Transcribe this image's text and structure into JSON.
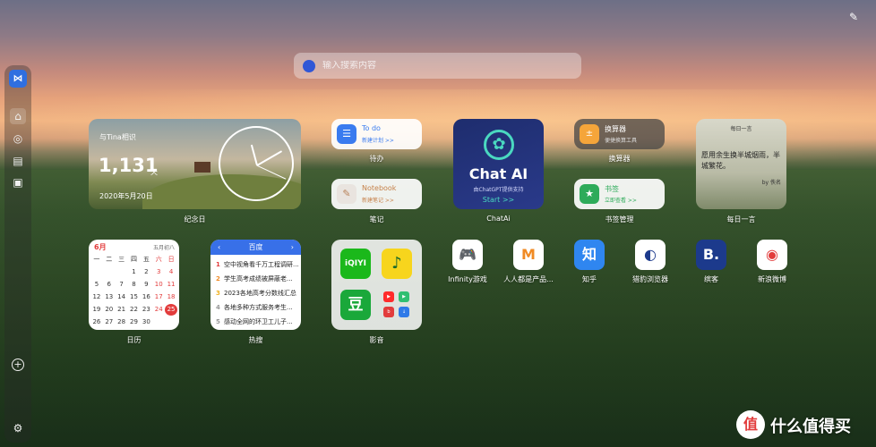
{
  "search": {
    "placeholder": "输入搜索内容"
  },
  "sidebar": {
    "items": [
      {
        "name": "home",
        "glyph": "⌂"
      },
      {
        "name": "compass",
        "glyph": "◎"
      },
      {
        "name": "store",
        "glyph": "▤"
      },
      {
        "name": "box",
        "glyph": "▣"
      }
    ],
    "add_glyph": "+",
    "settings_glyph": "⚙"
  },
  "anniversary": {
    "label": "与Tina相识",
    "count": "1,131",
    "unit": "天",
    "date": "2020年5月20日",
    "caption": "纪念日"
  },
  "todo": {
    "title": "To do",
    "subtitle": "新建计划 >>",
    "caption": "待办"
  },
  "notebook": {
    "title": "Notebook",
    "subtitle": "新建笔记 >>",
    "caption": "笔记"
  },
  "chatai": {
    "title": "Chat AI",
    "subtitle": "由ChatGPT提供支持",
    "start": "Start >>",
    "caption": "ChatAi"
  },
  "calculator": {
    "title": "换算器",
    "subtitle": "便捷换算工具",
    "caption": "换算器"
  },
  "bookmarks": {
    "title": "书签",
    "subtitle": "立即查看 >>",
    "caption": "书签管理"
  },
  "quote": {
    "header": "每日一言",
    "text": "愿用余生换半城烟雨，半城繁花。",
    "author": "by 佚名",
    "caption": "每日一言"
  },
  "calendar": {
    "month": "6月",
    "lunar": "五月初八",
    "weekdays": [
      "一",
      "二",
      "三",
      "四",
      "五",
      "六",
      "日"
    ],
    "days": [
      "",
      "",
      "",
      "1",
      "2",
      "3",
      "4",
      "5",
      "6",
      "7",
      "8",
      "9",
      "10",
      "11",
      "12",
      "13",
      "14",
      "15",
      "16",
      "17",
      "18",
      "19",
      "20",
      "21",
      "22",
      "23",
      "24",
      "25",
      "26",
      "27",
      "28",
      "29",
      "30",
      "",
      ""
    ],
    "today": "25",
    "caption": "日历"
  },
  "hotlist": {
    "title": "百度",
    "items": [
      {
        "rank": "1",
        "text": "空中视角看千万工程调研..."
      },
      {
        "rank": "2",
        "text": "学生高考成绩被屏蔽老..."
      },
      {
        "rank": "3",
        "text": "2023各地高考分数线汇总"
      },
      {
        "rank": "4",
        "text": "各地多种方式服务考生..."
      },
      {
        "rank": "5",
        "text": "感动全网的环卫工儿子..."
      }
    ],
    "caption": "热搜"
  },
  "media": {
    "caption": "影音",
    "apps": [
      {
        "name": "iqiyi",
        "label": "爱奇艺",
        "color": "#1bb81b",
        "text": "iQIYI"
      },
      {
        "name": "music",
        "label": "音乐",
        "color": "#f7d51d",
        "text": "♪"
      },
      {
        "name": "douban",
        "label": "豆瓣",
        "color": "#1aa83a",
        "text": "豆"
      }
    ],
    "mini": [
      {
        "name": "youtube",
        "label": "YouTube",
        "color": "#ff2b2b"
      },
      {
        "name": "googleplay",
        "label": "Play",
        "color": "#2fbf71"
      },
      {
        "name": "bilibili",
        "label": "哔哩",
        "color": "#e23c3c"
      },
      {
        "name": "downloader",
        "label": "下载",
        "color": "#2f7ae8"
      }
    ]
  },
  "apps": [
    {
      "name": "infinity-game",
      "label": "Infinity游戏",
      "bg": "#ffffff",
      "fg": "#3aa0e0",
      "glyph": "🎮"
    },
    {
      "name": "woshipm",
      "label": "人人都是产品...",
      "bg": "#ffffff",
      "fg": "#f08a24",
      "glyph": "M"
    },
    {
      "name": "zhihu",
      "label": "知乎",
      "bg": "#2f86f0",
      "fg": "#ffffff",
      "glyph": "知"
    },
    {
      "name": "cheetah-browser",
      "label": "猎豹浏览器",
      "bg": "#ffffff",
      "fg": "#1c3a8c",
      "glyph": "◐"
    },
    {
      "name": "bingke",
      "label": "缤客",
      "bg": "#1c3a8c",
      "fg": "#ffffff",
      "glyph": "B."
    },
    {
      "name": "weibo",
      "label": "新浪微博",
      "bg": "#ffffff",
      "fg": "#e23c3c",
      "glyph": "◉"
    }
  ],
  "watermark": {
    "text": "什么值得买",
    "mark": "值"
  }
}
